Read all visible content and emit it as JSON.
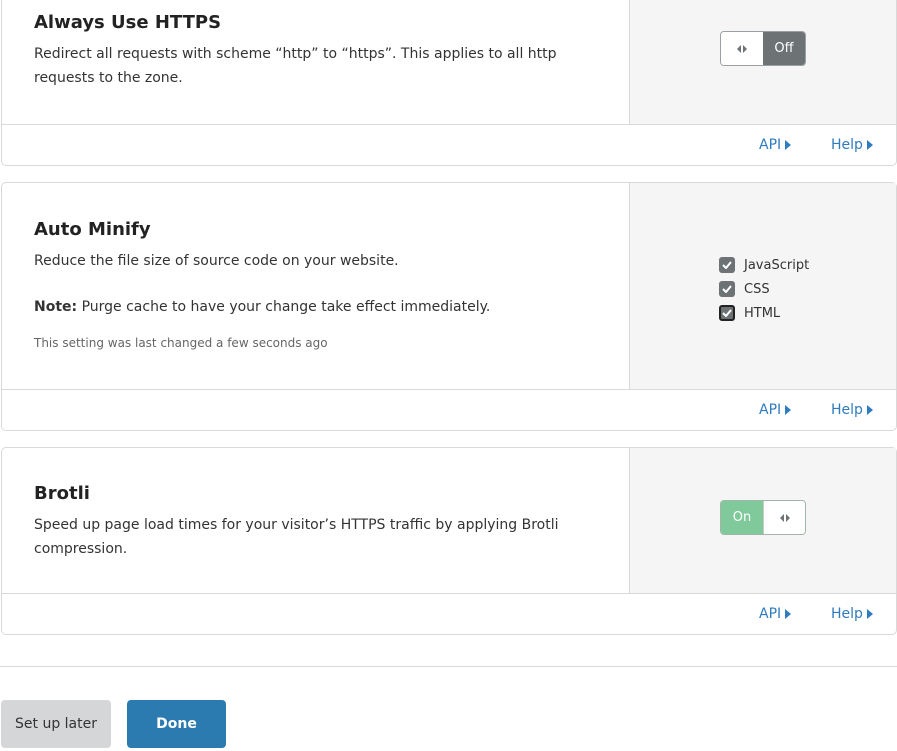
{
  "settings": [
    {
      "title": "Always Use HTTPS",
      "description": "Redirect all requests with scheme “http” to “https”. This applies to all http requests to the zone.",
      "control": "toggle",
      "state": "Off",
      "api_label": "API",
      "help_label": "Help"
    },
    {
      "title": "Auto Minify",
      "description": "Reduce the file size of source code on your website.",
      "note_label": "Note:",
      "note_text": " Purge cache to have your change take effect immediately.",
      "last_changed": "This setting was last changed a few seconds ago",
      "control": "checkboxes",
      "options": [
        {
          "label": "JavaScript",
          "checked": true
        },
        {
          "label": "CSS",
          "checked": true
        },
        {
          "label": "HTML",
          "checked": true
        }
      ],
      "api_label": "API",
      "help_label": "Help"
    },
    {
      "title": "Brotli",
      "description": "Speed up page load times for your visitor’s HTTPS traffic by applying Brotli compression.",
      "control": "toggle",
      "state": "On",
      "api_label": "API",
      "help_label": "Help"
    }
  ],
  "footer": {
    "setup_later_label": "Set up later",
    "done_label": "Done"
  },
  "colors": {
    "link": "#2f7bbf",
    "toggle_off": "#6d7275",
    "toggle_on": "#7fc99b",
    "primary_button": "#2c7bb0",
    "secondary_button": "#d5d6d8"
  }
}
